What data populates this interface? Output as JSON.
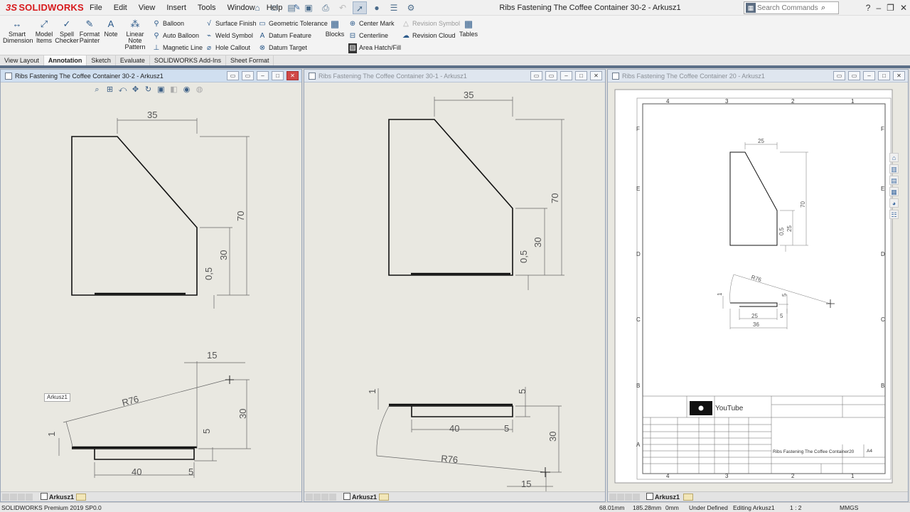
{
  "app": {
    "logo": "SOLIDWORKS",
    "window_title": "Ribs Fastening The Coffee Container 30-2 - Arkusz1",
    "menu": [
      "File",
      "Edit",
      "View",
      "Insert",
      "Tools",
      "Window",
      "Help"
    ],
    "search_placeholder": "Search Commands"
  },
  "ribbon": {
    "smart_dimension": "Smart Dimension",
    "model_items": "Model Items",
    "spell_checker": "Spell Checker",
    "format_painter": "Format Painter",
    "note": "Note",
    "linear_note_pattern": "Linear Note Pattern",
    "balloon": "Balloon",
    "auto_balloon": "Auto Balloon",
    "magnetic_line": "Magnetic Line",
    "surface_finish": "Surface Finish",
    "weld_symbol": "Weld Symbol",
    "hole_callout": "Hole Callout",
    "geometric_tolerance": "Geometric Tolerance",
    "datum_feature": "Datum Feature",
    "datum_target": "Datum Target",
    "blocks": "Blocks",
    "center_mark": "Center Mark",
    "centerline": "Centerline",
    "area_hatch": "Area Hatch/Fill",
    "revision_symbol": "Revision Symbol",
    "revision_cloud": "Revision Cloud",
    "tables": "Tables"
  },
  "tabs": [
    {
      "label": "View Layout",
      "active": false
    },
    {
      "label": "Annotation",
      "active": true
    },
    {
      "label": "Sketch",
      "active": false
    },
    {
      "label": "Evaluate",
      "active": false
    },
    {
      "label": "SOLIDWORKS Add-Ins",
      "active": false
    },
    {
      "label": "Sheet Format",
      "active": false
    }
  ],
  "windows": [
    {
      "title": "Ribs Fastening The Coffee Container 30-2 - Arkusz1",
      "sheet_tab": "Arkusz1",
      "sheet_label": "Arkusz1",
      "active": true,
      "front": {
        "dim_width": "35",
        "dim_height": "70",
        "dim_step": "30",
        "dim_thick": "0,5"
      },
      "bottom": {
        "dim_radius": "R76",
        "dim_top": "15",
        "dim_height": "30",
        "dim_base": "40",
        "dim_right": "5",
        "dim_right2": "5",
        "dim_left": "1"
      }
    },
    {
      "title": "Ribs Fastening The Coffee Container 30-1 - Arkusz1",
      "sheet_tab": "Arkusz1",
      "active": false,
      "front": {
        "dim_width": "35",
        "dim_height": "70",
        "dim_step": "30",
        "dim_thick": "0,5"
      },
      "bottom": {
        "dim_radius": "R76",
        "dim_top": "5",
        "dim_height": "30",
        "dim_base": "40",
        "dim_right": "5",
        "dim_bottom": "15",
        "dim_left": "1"
      }
    },
    {
      "title": "Ribs Fastening The Coffee Container 20 - Arkusz1",
      "sheet_tab": "Arkusz1",
      "active": false,
      "zones_cols": [
        "4",
        "3",
        "2",
        "1"
      ],
      "zones_rows": [
        "F",
        "E",
        "D",
        "C",
        "B",
        "A"
      ],
      "front": {
        "dim_width": "25",
        "dim_height": "70",
        "dim_step": "25",
        "dim_thick": "0,5"
      },
      "bottom": {
        "dim_radius": "R76",
        "dim_right": "5",
        "dim_base": "25",
        "dim_overall": "36",
        "dim_small": "5",
        "dim_left": "1"
      },
      "title_block": {
        "logo_text": "YouTube",
        "drawing_title": "Ribs Fastening The Coffee Container20",
        "size": "A4"
      }
    }
  ],
  "status": {
    "product": "SOLIDWORKS Premium 2019 SP0.0",
    "x": "68.01mm",
    "y": "185.28mm",
    "z": "0mm",
    "state": "Under Defined",
    "editing": "Editing Arkusz1",
    "scale": "1 : 2",
    "units": "MMGS"
  },
  "colors": {
    "accent": "#d7191c",
    "window_active": "#d0dff0",
    "band": "#5c6f88",
    "paper": "#e9e8e1"
  }
}
